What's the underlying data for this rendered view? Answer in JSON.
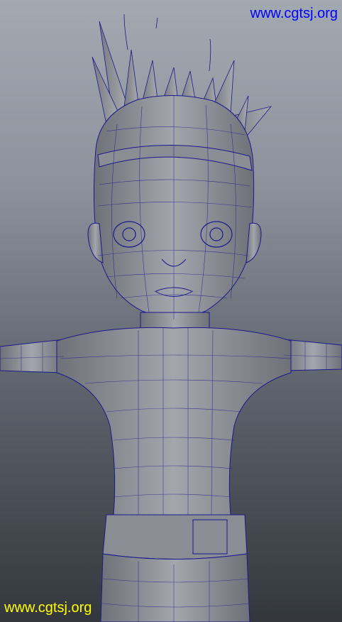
{
  "viewport": {
    "watermark_top": "www.cgtsj.org",
    "watermark_bottom": "www.cgtsj.org",
    "colors": {
      "background_top": "#a3a9b1",
      "background_bottom": "#33373d",
      "mesh_shade": "#8c8f95",
      "wireframe": "#1a1a8c",
      "watermark_top": "#0000ff",
      "watermark_bottom": "#ffff00"
    }
  }
}
